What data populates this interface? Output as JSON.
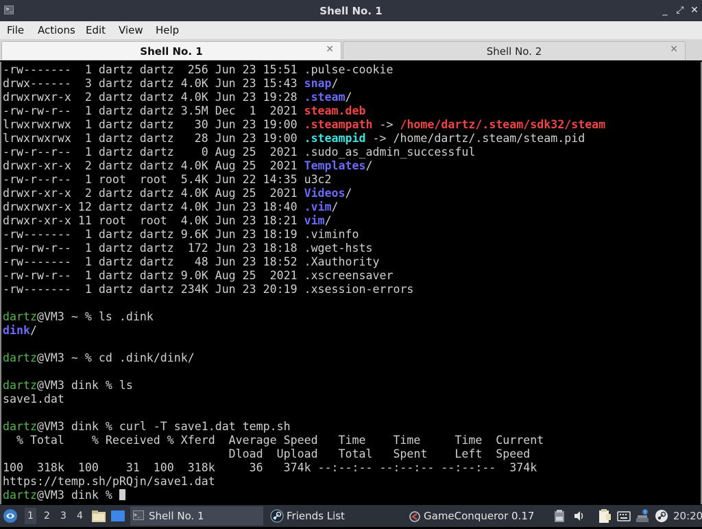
{
  "window": {
    "title": "Shell No. 1",
    "controls": [
      "_",
      "⤢",
      "✕"
    ]
  },
  "menu": [
    "File",
    "Actions",
    "Edit",
    "View",
    "Help"
  ],
  "tabs": [
    {
      "label": "Shell No. 1",
      "active": true
    },
    {
      "label": "Shell No. 2",
      "active": false
    }
  ],
  "terminal": {
    "listing": [
      {
        "perm": "-rw-------",
        "links": " 1",
        "owner": "dartz",
        "group": "dartz",
        "size": " 256",
        "date": "Jun 23 15:51",
        "name": ".pulse-cookie",
        "style": "plain",
        "suffix": ""
      },
      {
        "perm": "drwx------",
        "links": " 3",
        "owner": "dartz",
        "group": "dartz",
        "size": "4.0K",
        "date": "Jun 23 15:43",
        "name": "snap",
        "style": "dir",
        "suffix": "/"
      },
      {
        "perm": "drwxrwxr-x",
        "links": " 2",
        "owner": "dartz",
        "group": "dartz",
        "size": "4.0K",
        "date": "Jun 23 19:28",
        "name": ".steam",
        "style": "dir",
        "suffix": "/"
      },
      {
        "perm": "-rw-rw-r--",
        "links": " 1",
        "owner": "dartz",
        "group": "dartz",
        "size": "3.5M",
        "date": "Dec  1  2021",
        "name": "steam.deb",
        "style": "red",
        "suffix": ""
      },
      {
        "perm": "lrwxrwxrwx",
        "links": " 1",
        "owner": "dartz",
        "group": "dartz",
        "size": "  30",
        "date": "Jun 23 19:00",
        "name": ".steampath",
        "style": "red",
        "suffix": " -> ",
        "target": "/home/dartz/.steam/sdk32/steam",
        "target_style": "red"
      },
      {
        "perm": "lrwxrwxrwx",
        "links": " 1",
        "owner": "dartz",
        "group": "dartz",
        "size": "  28",
        "date": "Jun 23 19:00",
        "name": ".steampid",
        "style": "cyan",
        "suffix": " -> ",
        "target": "/home/dartz/.steam/steam.pid",
        "target_style": "plain"
      },
      {
        "perm": "-rw-r--r--",
        "links": " 1",
        "owner": "dartz",
        "group": "dartz",
        "size": "   0",
        "date": "Aug 25  2021",
        "name": ".sudo_as_admin_successful",
        "style": "plain",
        "suffix": ""
      },
      {
        "perm": "drwxr-xr-x",
        "links": " 2",
        "owner": "dartz",
        "group": "dartz",
        "size": "4.0K",
        "date": "Aug 25  2021",
        "name": "Templates",
        "style": "dir",
        "suffix": "/"
      },
      {
        "perm": "-rw-r--r--",
        "links": " 1",
        "owner": "root ",
        "group": "root ",
        "size": "5.4K",
        "date": "Jun 22 14:35",
        "name": "u3c2",
        "style": "plain",
        "suffix": ""
      },
      {
        "perm": "drwxr-xr-x",
        "links": " 2",
        "owner": "dartz",
        "group": "dartz",
        "size": "4.0K",
        "date": "Aug 25  2021",
        "name": "Videos",
        "style": "dir",
        "suffix": "/"
      },
      {
        "perm": "drwxrwxr-x",
        "links": "12",
        "owner": "dartz",
        "group": "dartz",
        "size": "4.0K",
        "date": "Jun 23 18:40",
        "name": ".vim",
        "style": "dir",
        "suffix": "/"
      },
      {
        "perm": "drwxr-xr-x",
        "links": "11",
        "owner": "root ",
        "group": "root ",
        "size": "4.0K",
        "date": "Jun 23 18:21",
        "name": "vim",
        "style": "dir",
        "suffix": "/"
      },
      {
        "perm": "-rw-------",
        "links": " 1",
        "owner": "dartz",
        "group": "dartz",
        "size": "9.6K",
        "date": "Jun 23 18:19",
        "name": ".viminfo",
        "style": "plain",
        "suffix": ""
      },
      {
        "perm": "-rw-rw-r--",
        "links": " 1",
        "owner": "dartz",
        "group": "dartz",
        "size": " 172",
        "date": "Jun 23 18:18",
        "name": ".wget-hsts",
        "style": "plain",
        "suffix": ""
      },
      {
        "perm": "-rw-------",
        "links": " 1",
        "owner": "dartz",
        "group": "dartz",
        "size": "  48",
        "date": "Jun 23 18:52",
        "name": ".Xauthority",
        "style": "plain",
        "suffix": ""
      },
      {
        "perm": "-rw-rw-r--",
        "links": " 1",
        "owner": "dartz",
        "group": "dartz",
        "size": "9.0K",
        "date": "Aug 25  2021",
        "name": ".xscreensaver",
        "style": "plain",
        "suffix": ""
      },
      {
        "perm": "-rw-------",
        "links": " 1",
        "owner": "dartz",
        "group": "dartz",
        "size": "234K",
        "date": "Jun 23 20:19",
        "name": ".xsession-errors",
        "style": "plain",
        "suffix": ""
      }
    ],
    "session": [
      {
        "kind": "blank"
      },
      {
        "kind": "prompt",
        "user": "dartz",
        "host": "@VM3 ~ % ",
        "cmd": "ls .dink"
      },
      {
        "kind": "dir",
        "name": "dink",
        "suffix": "/"
      },
      {
        "kind": "blank"
      },
      {
        "kind": "prompt",
        "user": "dartz",
        "host": "@VM3 ~ % ",
        "cmd": "cd .dink/dink/"
      },
      {
        "kind": "blank"
      },
      {
        "kind": "prompt",
        "user": "dartz",
        "host": "@VM3 dink % ",
        "cmd": "ls"
      },
      {
        "kind": "text",
        "text": "save1.dat"
      },
      {
        "kind": "blank"
      },
      {
        "kind": "prompt",
        "user": "dartz",
        "host": "@VM3 dink % ",
        "cmd": "curl -T save1.dat temp.sh"
      },
      {
        "kind": "text",
        "text": "  % Total    % Received % Xferd  Average Speed   Time    Time     Time  Current"
      },
      {
        "kind": "text",
        "text": "                                 Dload  Upload   Total   Spent    Left  Speed"
      },
      {
        "kind": "text",
        "text": "100  318k  100    31  100  318k     36   374k --:--:-- --:--:-- --:--:--  374k"
      },
      {
        "kind": "text",
        "text": "https://temp.sh/pRQjn/save1.dat"
      },
      {
        "kind": "prompt",
        "user": "dartz",
        "host": "@VM3 dink % ",
        "cmd": "",
        "cursor": true
      }
    ]
  },
  "taskbar": {
    "workspaces": [
      "1",
      "2",
      "3",
      "4"
    ],
    "tasks": [
      {
        "label": "Shell No. 1",
        "icon": "terminal-icon",
        "active": true
      },
      {
        "label": "Friends List",
        "icon": "steam-icon",
        "active": false
      },
      {
        "label": "GameConqueror 0.17",
        "icon": "gameconqueror-icon",
        "active": false
      }
    ],
    "clock": "20:20"
  }
}
